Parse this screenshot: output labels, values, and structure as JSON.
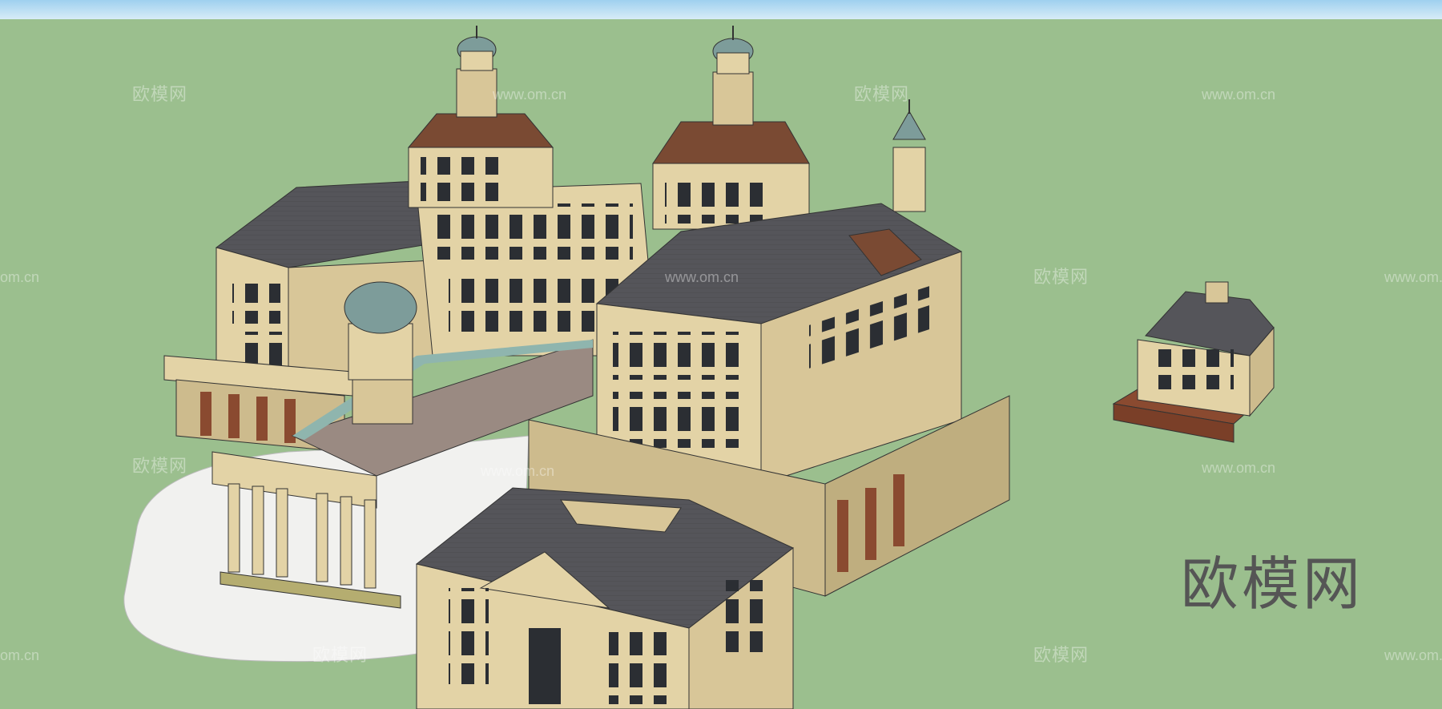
{
  "watermarks": {
    "logo_text": "欧模网",
    "url_text": "www.om.cn",
    "partial_url_text": "om.cn"
  },
  "colors": {
    "ground": "#9bbf8e",
    "sky": "#b9def2",
    "wall": "#e3d3a6",
    "wall_shade": "#cdbb8d",
    "roof": "#55555a",
    "roof_brown": "#7a4a33",
    "dome": "#7d9c9a",
    "brick": "#8a4a30",
    "window": "#2b2e33",
    "plaza": "#f1f1ef",
    "canopy": "#9a8a82"
  },
  "icons": [
    "house-icon"
  ]
}
